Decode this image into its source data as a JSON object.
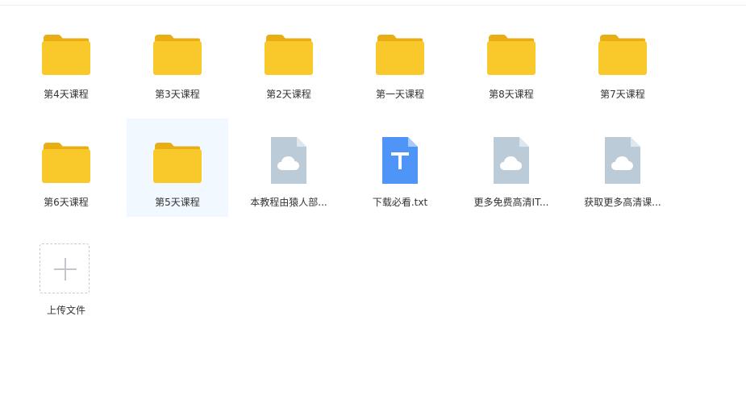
{
  "items": [
    {
      "name": "第4天课程",
      "type": "folder"
    },
    {
      "name": "第3天课程",
      "type": "folder"
    },
    {
      "name": "第2天课程",
      "type": "folder"
    },
    {
      "name": "第一天课程",
      "type": "folder"
    },
    {
      "name": "第8天课程",
      "type": "folder"
    },
    {
      "name": "第7天课程",
      "type": "folder"
    },
    {
      "name": "第6天课程",
      "type": "folder"
    },
    {
      "name": "第5天课程",
      "type": "folder",
      "selected": true
    },
    {
      "name": "本教程由猿人部...",
      "type": "cloud-file"
    },
    {
      "name": "下载必看.txt",
      "type": "txt-file"
    },
    {
      "name": "更多免费高清IT...",
      "type": "cloud-file"
    },
    {
      "name": "获取更多高清课...",
      "type": "cloud-file"
    }
  ],
  "upload": {
    "label": "上传文件"
  },
  "colors": {
    "folder_body": "#f9c92c",
    "folder_tab": "#e8ae13",
    "cloud_file": "#bccbd8",
    "cloud_file_fold": "#dfe7ee",
    "txt_file": "#4f95f7",
    "txt_file_fold": "#a9cbfb",
    "selected_bg": "#f1f8ff"
  }
}
